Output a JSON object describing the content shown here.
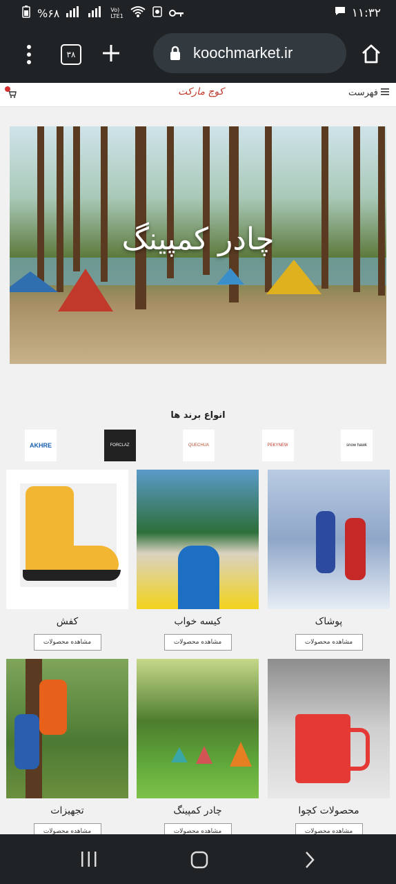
{
  "status": {
    "time": "۱۱:۳۲",
    "battery": "%۶۸",
    "signal_labels": [
      "Vo)",
      "LTE1"
    ]
  },
  "browser": {
    "tab_count": "۳۸",
    "url": "koochmarket.ir"
  },
  "site": {
    "menu_label": "فهرست",
    "logo_text": "کوچ مارکت"
  },
  "hero": {
    "title": "چادر کمپینگ"
  },
  "brands_section": {
    "title": "انواع برند ها",
    "brands": [
      "snow hawk",
      "PEKYNEW",
      "QUECHUA",
      "FORCLAZ",
      "AKHRE"
    ]
  },
  "categories": [
    {
      "name": "پوشاک",
      "button": "مشاهده محصولات"
    },
    {
      "name": "کیسه خواب",
      "button": "مشاهده محصولات"
    },
    {
      "name": "کفش",
      "button": "مشاهده محصولات"
    },
    {
      "name": "محصولات کچوا",
      "button": "مشاهده محصولات"
    },
    {
      "name": "چادر کمپینگ",
      "button": "مشاهده محصولات"
    },
    {
      "name": "تجهیزات",
      "button": "مشاهده محصولات"
    }
  ],
  "colors": {
    "system_bar": "#1f2326",
    "url_pill": "#333a3f",
    "page_bg": "#f1f1f1",
    "logo": "#c0392b"
  }
}
